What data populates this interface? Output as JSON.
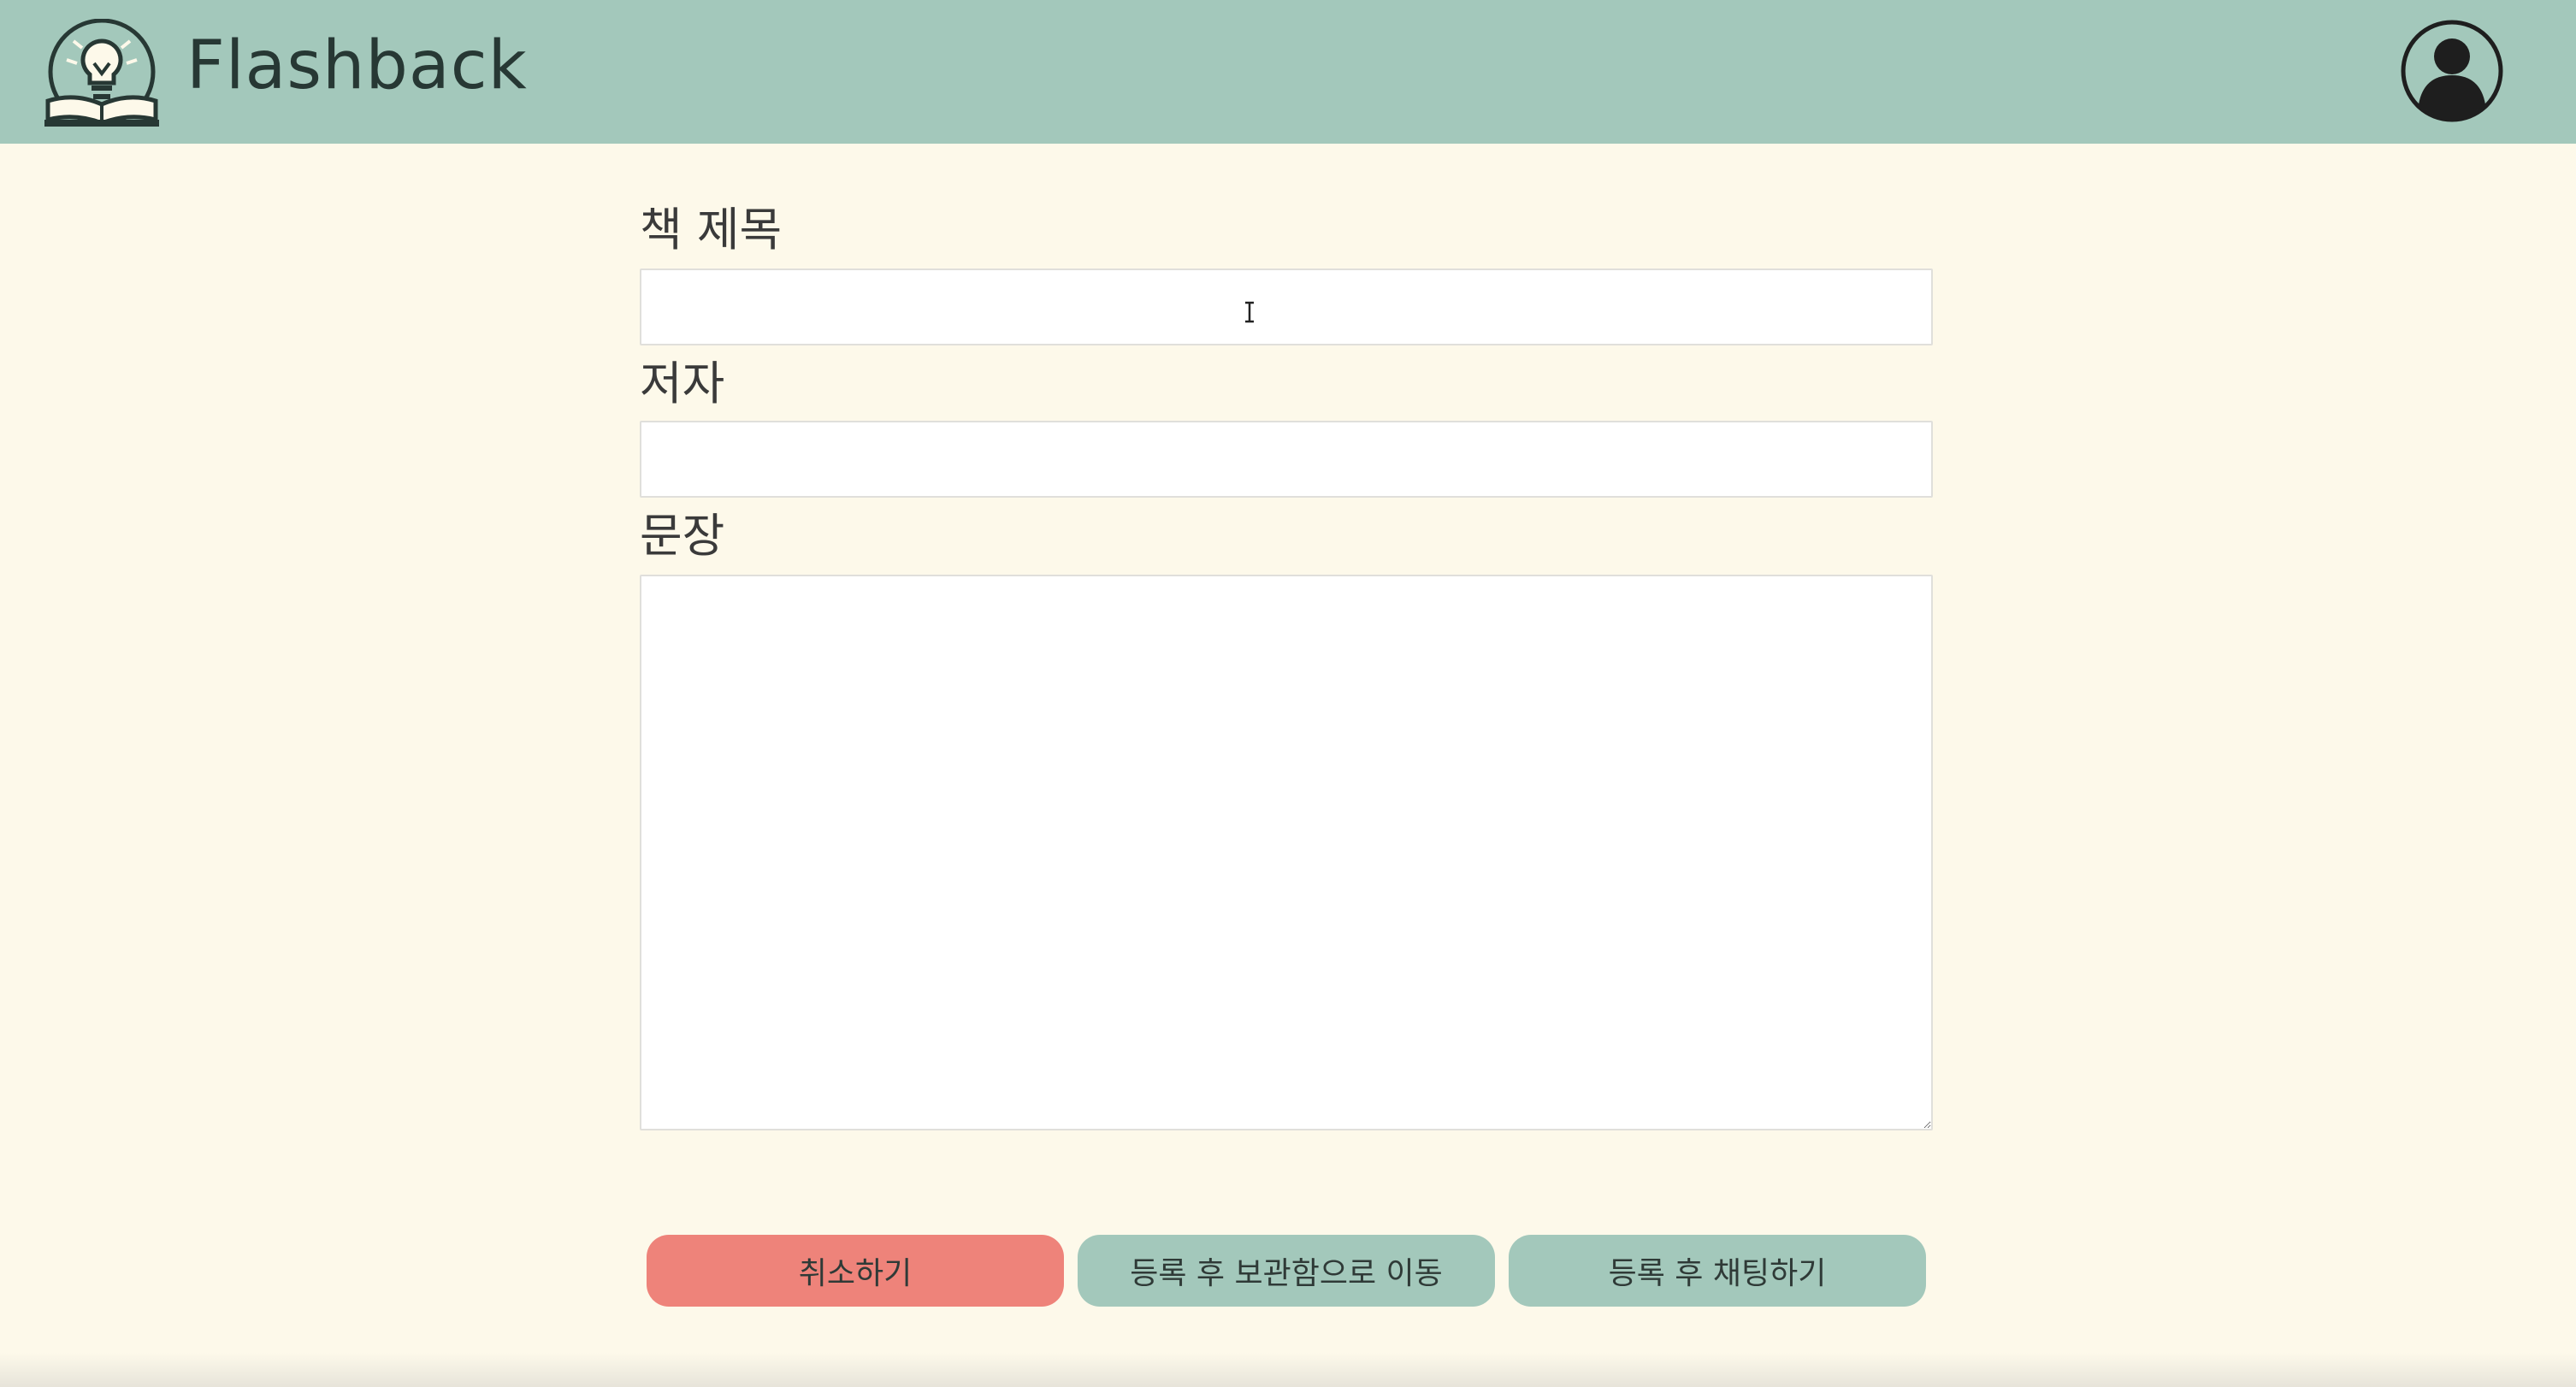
{
  "header": {
    "app_title": "Flashback",
    "logo_icon": "lightbulb-book-icon",
    "avatar_icon": "user-avatar-icon"
  },
  "form": {
    "title_label": "책 제목",
    "title_value": "",
    "author_label": "저자",
    "author_value": "",
    "sentence_label": "문장",
    "sentence_value": ""
  },
  "buttons": {
    "cancel": "취소하기",
    "register_archive": "등록 후 보관함으로 이동",
    "register_grade": "등록 후 채팅하기"
  },
  "colors": {
    "header_bg": "#a3c8bb",
    "page_bg": "#fdf9ea",
    "cancel_bg": "#ee837a",
    "primary_bg": "#a3c8bb"
  }
}
